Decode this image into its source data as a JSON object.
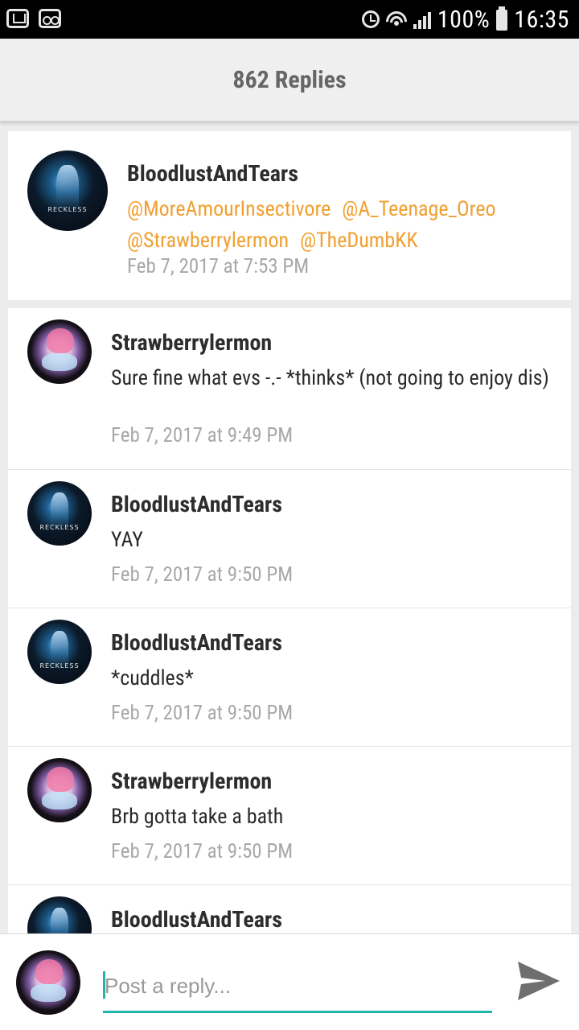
{
  "status_bar": {
    "battery": "100%",
    "time": "16:35"
  },
  "header": {
    "title": "862 Replies"
  },
  "original_post": {
    "author": "BloodlustAndTears",
    "mentions": [
      "@MoreAmourInsectivore",
      "@A_Teenage_Oreo",
      "@Strawberrylermon",
      "@TheDumbKK"
    ],
    "timestamp": "Feb 7, 2017 at 7:53 PM",
    "avatar": "dark-blue-avatar"
  },
  "replies": [
    {
      "author": "Strawberrylermon",
      "text": "Sure fine what evs -.- *thinks* (not going to enjoy dis)",
      "timestamp": "Feb 7, 2017 at 9:49 PM",
      "avatar": "pony-avatar"
    },
    {
      "author": "BloodlustAndTears",
      "text": "YAY",
      "timestamp": "Feb 7, 2017 at 9:50 PM",
      "avatar": "dark-blue-avatar"
    },
    {
      "author": "BloodlustAndTears",
      "text": "*cuddles*",
      "timestamp": "Feb 7, 2017 at 9:50 PM",
      "avatar": "dark-blue-avatar"
    },
    {
      "author": "Strawberrylermon",
      "text": "Brb gotta take a bath",
      "timestamp": "Feb 7, 2017 at 9:50 PM",
      "avatar": "pony-avatar"
    },
    {
      "author": "BloodlustAndTears",
      "avatar": "dark-blue-avatar"
    }
  ],
  "reply_bar": {
    "placeholder": "Post a reply...",
    "value": "",
    "send_icon": "send-icon"
  },
  "colors": {
    "accent": "#1fb5ac",
    "mention": "#f0a030",
    "timestamp": "#a8a8a8"
  }
}
